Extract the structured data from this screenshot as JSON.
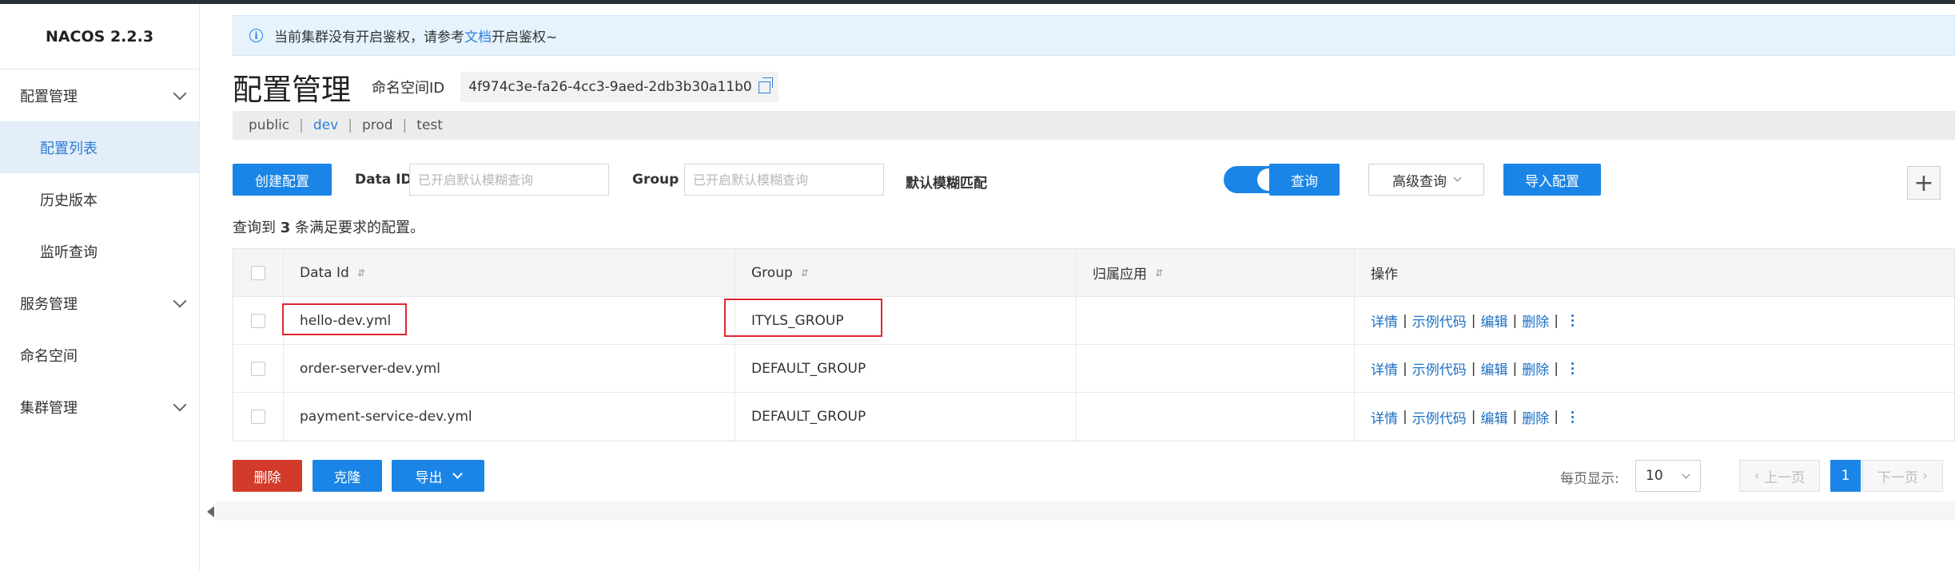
{
  "app": {
    "logo": "NACOS 2.2.3"
  },
  "sidebar": {
    "items": [
      {
        "label": "配置管理",
        "expandable": true
      },
      {
        "label": "配置列表",
        "active": true
      },
      {
        "label": "历史版本"
      },
      {
        "label": "监听查询"
      },
      {
        "label": "服务管理",
        "expandable": true
      },
      {
        "label": "命名空间"
      },
      {
        "label": "集群管理",
        "expandable": true
      }
    ]
  },
  "notice": {
    "prefix": "当前集群没有开启鉴权，请参考",
    "link": "文档",
    "suffix": "开启鉴权~"
  },
  "header": {
    "title": "配置管理",
    "namespace_label": "命名空间ID",
    "namespace_id": "4f974c3e-fa26-4cc3-9aed-2db3b30a11b0"
  },
  "namespaces": [
    "public",
    "dev",
    "prod",
    "test"
  ],
  "active_namespace": "dev",
  "search": {
    "create_label": "创建配置",
    "dataid_label": "Data ID",
    "dataid_placeholder": "已开启默认模糊查询",
    "group_label": "Group",
    "group_placeholder": "已开启默认模糊查询",
    "fuzzy_label": "默认模糊匹配",
    "fuzzy_on": true,
    "query_label": "查询",
    "advanced_label": "高级查询",
    "import_label": "导入配置",
    "plus": "+"
  },
  "result": {
    "prefix": "查询到",
    "count": "3",
    "suffix": "条满足要求的配置。"
  },
  "table": {
    "headers": [
      "Data Id",
      "Group",
      "归属应用",
      "操作"
    ],
    "rows": [
      {
        "data_id": "hello-dev.yml",
        "group": "ITYLS_GROUP",
        "app": "",
        "highlighted": true
      },
      {
        "data_id": "order-server-dev.yml",
        "group": "DEFAULT_GROUP",
        "app": ""
      },
      {
        "data_id": "payment-service-dev.yml",
        "group": "DEFAULT_GROUP",
        "app": ""
      }
    ],
    "ops": {
      "detail": "详情",
      "sample": "示例代码",
      "edit": "编辑",
      "delete": "删除",
      "sep": "|"
    }
  },
  "bottom": {
    "delete_label": "删除",
    "clone_label": "克隆",
    "export_label": "导出",
    "page_size_label": "每页显示:",
    "page_size": "10",
    "prev_label": "上一页",
    "current_page": "1",
    "next_label": "下一页"
  },
  "colors": {
    "primary": "#1a85e6",
    "danger": "#d23a2a",
    "highlight": "#e0262f"
  }
}
